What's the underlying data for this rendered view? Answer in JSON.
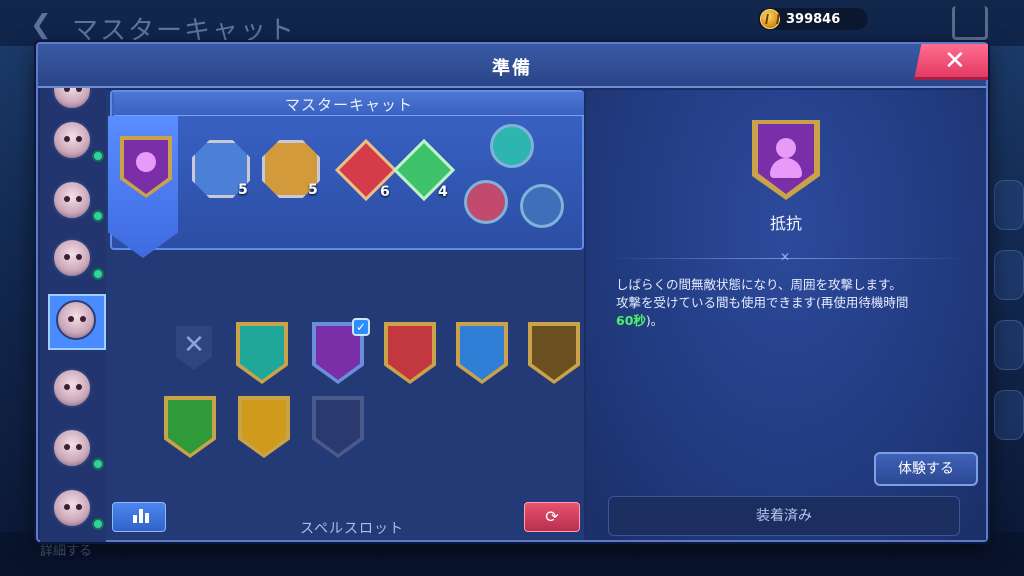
{
  "background": {
    "title": "マスターキャット",
    "back_glyph": "❮",
    "bottom_label": "詳細する",
    "currency": {
      "icon": "gold-coin-icon",
      "amount": "399846"
    }
  },
  "dialog": {
    "title": "準備",
    "close_glyph": "✕"
  },
  "slot_panel": {
    "title": "マスターキャット",
    "badges": [
      {
        "icon": "whale-badge-icon",
        "level": "5",
        "color": "#4c7fd6"
      },
      {
        "icon": "armadillo-badge-icon",
        "level": "5",
        "color": "#d39a3c"
      },
      {
        "icon": "red-diamond-badge-icon",
        "level": "6",
        "color": "#d63b4a"
      },
      {
        "icon": "green-heart-badge-icon",
        "level": "4",
        "color": "#3ec26c"
      }
    ],
    "runes": [
      {
        "icon": "cyan-swirl-rune-icon",
        "color": "#2fb5b0"
      },
      {
        "icon": "pink-eye-rune-icon",
        "color": "#c24a6e"
      },
      {
        "icon": "blue-dash-rune-icon",
        "color": "#3f6fb8"
      }
    ],
    "spells": [
      {
        "icon": "empty-slot-icon",
        "color": "#2f4480",
        "selected": false
      },
      {
        "icon": "teal-crescent-spell-icon",
        "color": "#1fa89a",
        "selected": false
      },
      {
        "icon": "purple-figure-spell-icon",
        "color": "#7a2fa8",
        "selected": true
      },
      {
        "icon": "red-burst-spell-icon",
        "color": "#c2383e",
        "selected": false
      },
      {
        "icon": "blue-wing-spell-icon",
        "color": "#2f7fd6",
        "selected": false
      },
      {
        "icon": "gold-eye-spell-icon",
        "color": "#6a5020",
        "selected": false
      },
      {
        "icon": "green-heart-spell-icon",
        "color": "#2e9a3a",
        "selected": false
      },
      {
        "icon": "gold-star-spell-icon",
        "color": "#d09a1c",
        "selected": false
      },
      {
        "icon": "gray-outline-spell-icon",
        "color": "#2a3a70",
        "selected": false
      }
    ],
    "spell_slot_label": "スペルスロット",
    "refresh_glyph": "⟳"
  },
  "detail": {
    "icon": "purple-figure-spell-icon",
    "name": "抵抗",
    "divider_mark": "✕",
    "desc_line1": "しばらくの間無敵状態になり、周囲を攻撃します。",
    "desc_line2": "攻撃を受けている間も使用できます(再使用待機時間",
    "desc_line3_hl": "60秒",
    "desc_line3_tail": ")。",
    "try_label": "体験する",
    "equipped_label": "装着済み"
  }
}
